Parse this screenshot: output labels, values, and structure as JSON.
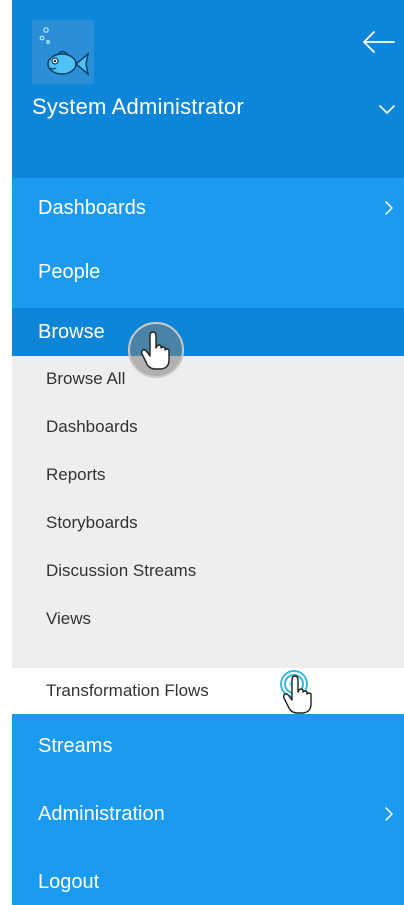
{
  "user": {
    "name": "System Administrator"
  },
  "menu": {
    "dashboards": "Dashboards",
    "people": "People",
    "browse": "Browse",
    "streams": "Streams",
    "administration": "Administration",
    "logout": "Logout"
  },
  "browse_submenu": [
    {
      "label": "Browse All"
    },
    {
      "label": "Dashboards"
    },
    {
      "label": "Reports"
    },
    {
      "label": "Storyboards"
    },
    {
      "label": "Discussion Streams"
    },
    {
      "label": "Views"
    },
    {
      "label": "Transformation Flows"
    }
  ],
  "colors": {
    "menu_bg": "#1a9bef",
    "header_bg": "#0d85d8",
    "active_bg": "#0d85d8",
    "submenu_bg": "#eeeeee",
    "selected_bg": "#ffffff"
  },
  "icons": {
    "back": "arrow-left-icon",
    "expand": "chevron-down-icon",
    "submenu": "chevron-right-icon",
    "pointer": "hand-pointer-icon"
  }
}
